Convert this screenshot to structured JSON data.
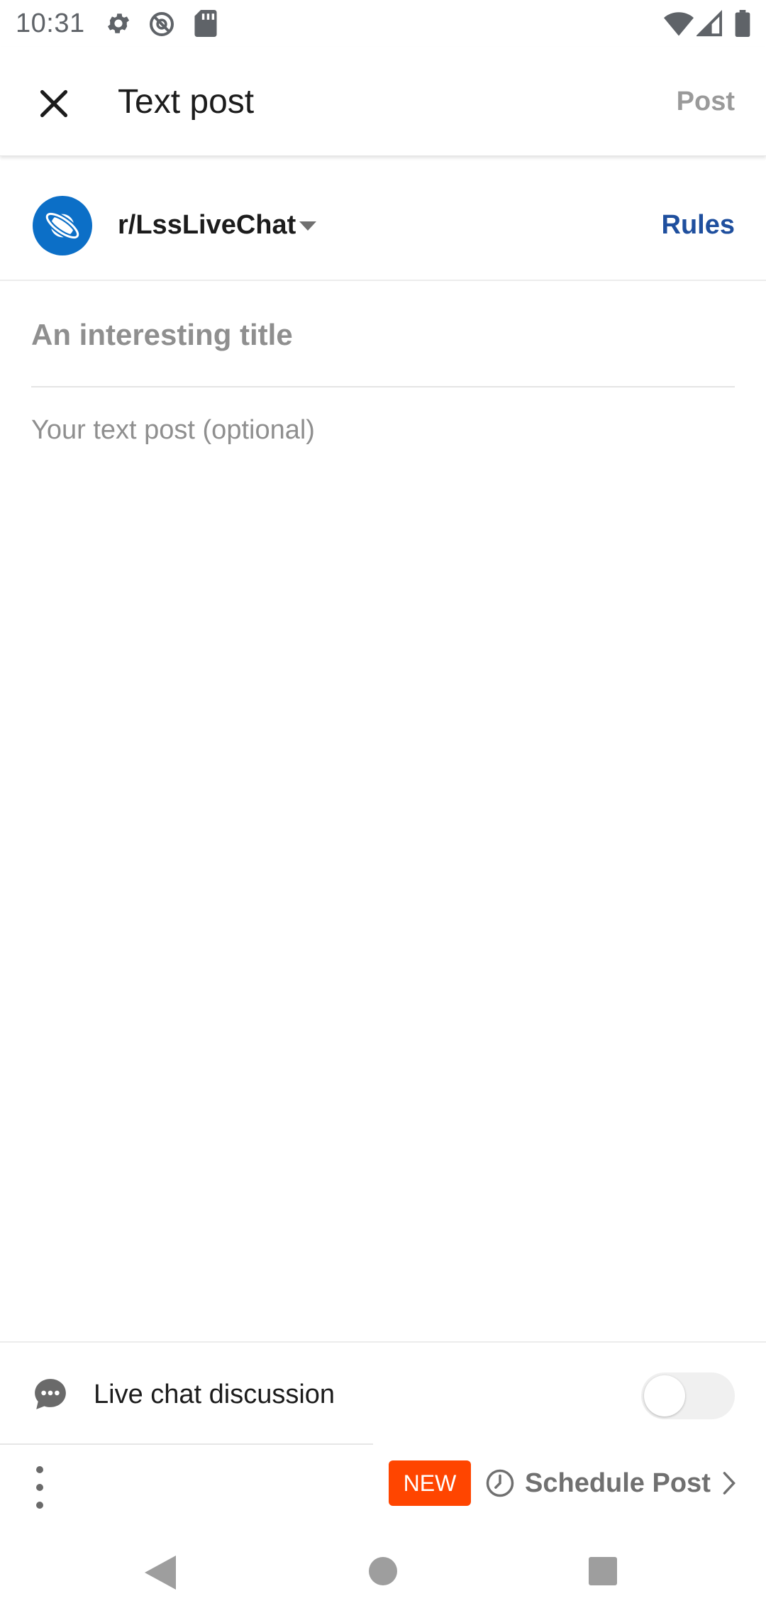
{
  "status_bar": {
    "time": "10:31",
    "icons": [
      "settings-icon",
      "vpn-icon",
      "sd-card-icon",
      "wifi-icon",
      "signal-icon",
      "battery-icon"
    ]
  },
  "toolbar": {
    "title": "Text post",
    "post_label": "Post",
    "close_icon": "close-icon"
  },
  "community": {
    "name": "r/LssLiveChat",
    "rules_label": "Rules",
    "avatar_icon": "planet-icon",
    "avatar_color": "#0c6fc7"
  },
  "composer": {
    "title_placeholder": "An interesting title",
    "title_value": "",
    "body_placeholder": "Your text post (optional)",
    "body_value": ""
  },
  "live_chat": {
    "label": "Live chat discussion",
    "enabled": false,
    "icon": "chat-bubble-icon"
  },
  "bottom_bar": {
    "badge": "NEW",
    "badge_color": "#ff4500",
    "schedule_label": "Schedule Post",
    "more_icon": "more-vertical-icon",
    "clock_icon": "clock-icon"
  },
  "colors": {
    "accent_link": "#1f4f9e",
    "muted_text": "#8f8f8f"
  }
}
